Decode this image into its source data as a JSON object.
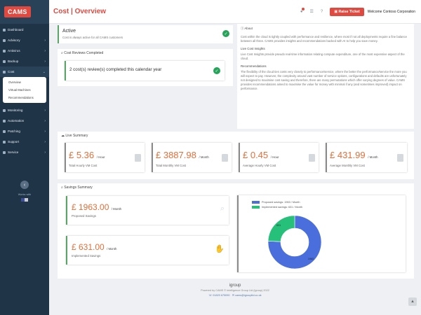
{
  "app": {
    "logo": "CAMS"
  },
  "sidebar": {
    "items": [
      {
        "label": "Dashboard",
        "has_chevron": false
      },
      {
        "label": "Advisory",
        "has_chevron": true
      },
      {
        "label": "Antivirus",
        "has_chevron": true
      },
      {
        "label": "Backup",
        "has_chevron": true
      },
      {
        "label": "Cost",
        "has_chevron": true
      }
    ],
    "cost_subitems": [
      "Overview",
      "Virtual Machines",
      "Recommendations"
    ],
    "items_after": [
      {
        "label": "Monitoring"
      },
      {
        "label": "Automation"
      },
      {
        "label": "Patching"
      },
      {
        "label": "Support"
      },
      {
        "label": "Service"
      }
    ],
    "collapse_glyph": "‹",
    "works_with": "Works with"
  },
  "header": {
    "title": "Cost | Overview",
    "raise_ticket": "Raise Ticket",
    "welcome": "Welcome Contoso Corporation",
    "icons": [
      "bell-icon",
      "grid-icon",
      "help-icon"
    ]
  },
  "status": {
    "title": "Active",
    "subtitle": "Cost is always active for all CAMS customers"
  },
  "reviews": {
    "heading": "Cost Reviews Completed",
    "text": "2 cost(s) review(s) completed this calendar year"
  },
  "about": {
    "heading": "About",
    "intro": "Cost within the cloud is tightly coupled with performance and resilience, where most if not all deployments require a fine balance between all three. CAMS provides insights and recommendations backed with AI to help you save money.",
    "insights_heading": "Live Cost Insights",
    "insights_text": "Live Cost Insights provide pseudo real-time information relating compute expenditure, one of the most expensive aspect of the cloud.",
    "recs_heading": "Recommendations",
    "recs_text": "The flexibility of the cloud ties costs very closely to performance/service, where the better the performance/service the more you will expect to pay. However, the complexity around vast number of service options, configurations and defaults are unfortunately not designed to maximise cost saving and therefore, there are many permutations which offer varying degrees of value. CAMS provides recommendations aimed to maximise the value for money with minimal if any (and sometimes improved) impact on performance."
  },
  "live_summary": {
    "heading": "Live Summary",
    "cards": [
      {
        "value": "£ 5.36",
        "unit": "/ Hour",
        "label": "Total Hourly VM Cost"
      },
      {
        "value": "£ 3887.98",
        "unit": "/ Month",
        "label": "Total Monthly VM Cost"
      },
      {
        "value": "£ 0.45",
        "unit": "/ Hour",
        "label": "Average Hourly VM Cost"
      },
      {
        "value": "£ 431.99",
        "unit": "/ Month",
        "label": "Average Monthly VM Cost"
      }
    ]
  },
  "savings": {
    "heading": "Savings Summary",
    "proposed": {
      "value": "£ 1963.00",
      "unit": "/ Month",
      "label": "Proposed Savings"
    },
    "implemented": {
      "value": "£ 631.00",
      "unit": "/ Month",
      "label": "Implemented Savings"
    }
  },
  "chart_data": {
    "type": "pie",
    "title": "",
    "series": [
      {
        "name": "Proposed savings: 1963 / Month",
        "value": 1963,
        "label": "1963",
        "color": "#4a6fdc"
      },
      {
        "name": "Implemented savings: 631 / Month",
        "value": 631,
        "label": "631",
        "color": "#27c07a"
      }
    ],
    "legend_position": "top"
  },
  "footer": {
    "brand": "igroup",
    "powered": "Powered by CAMS © Intelligence Group Ltd (igroup) 2022",
    "phone": "01823 675090",
    "email": "cams@igroupltd.co.uk",
    "scroll_glyph": "▲"
  },
  "colors": {
    "accent": "#e0493f",
    "value": "#e46f3a",
    "success": "#27a35a",
    "sidebar": "#1f3447"
  }
}
